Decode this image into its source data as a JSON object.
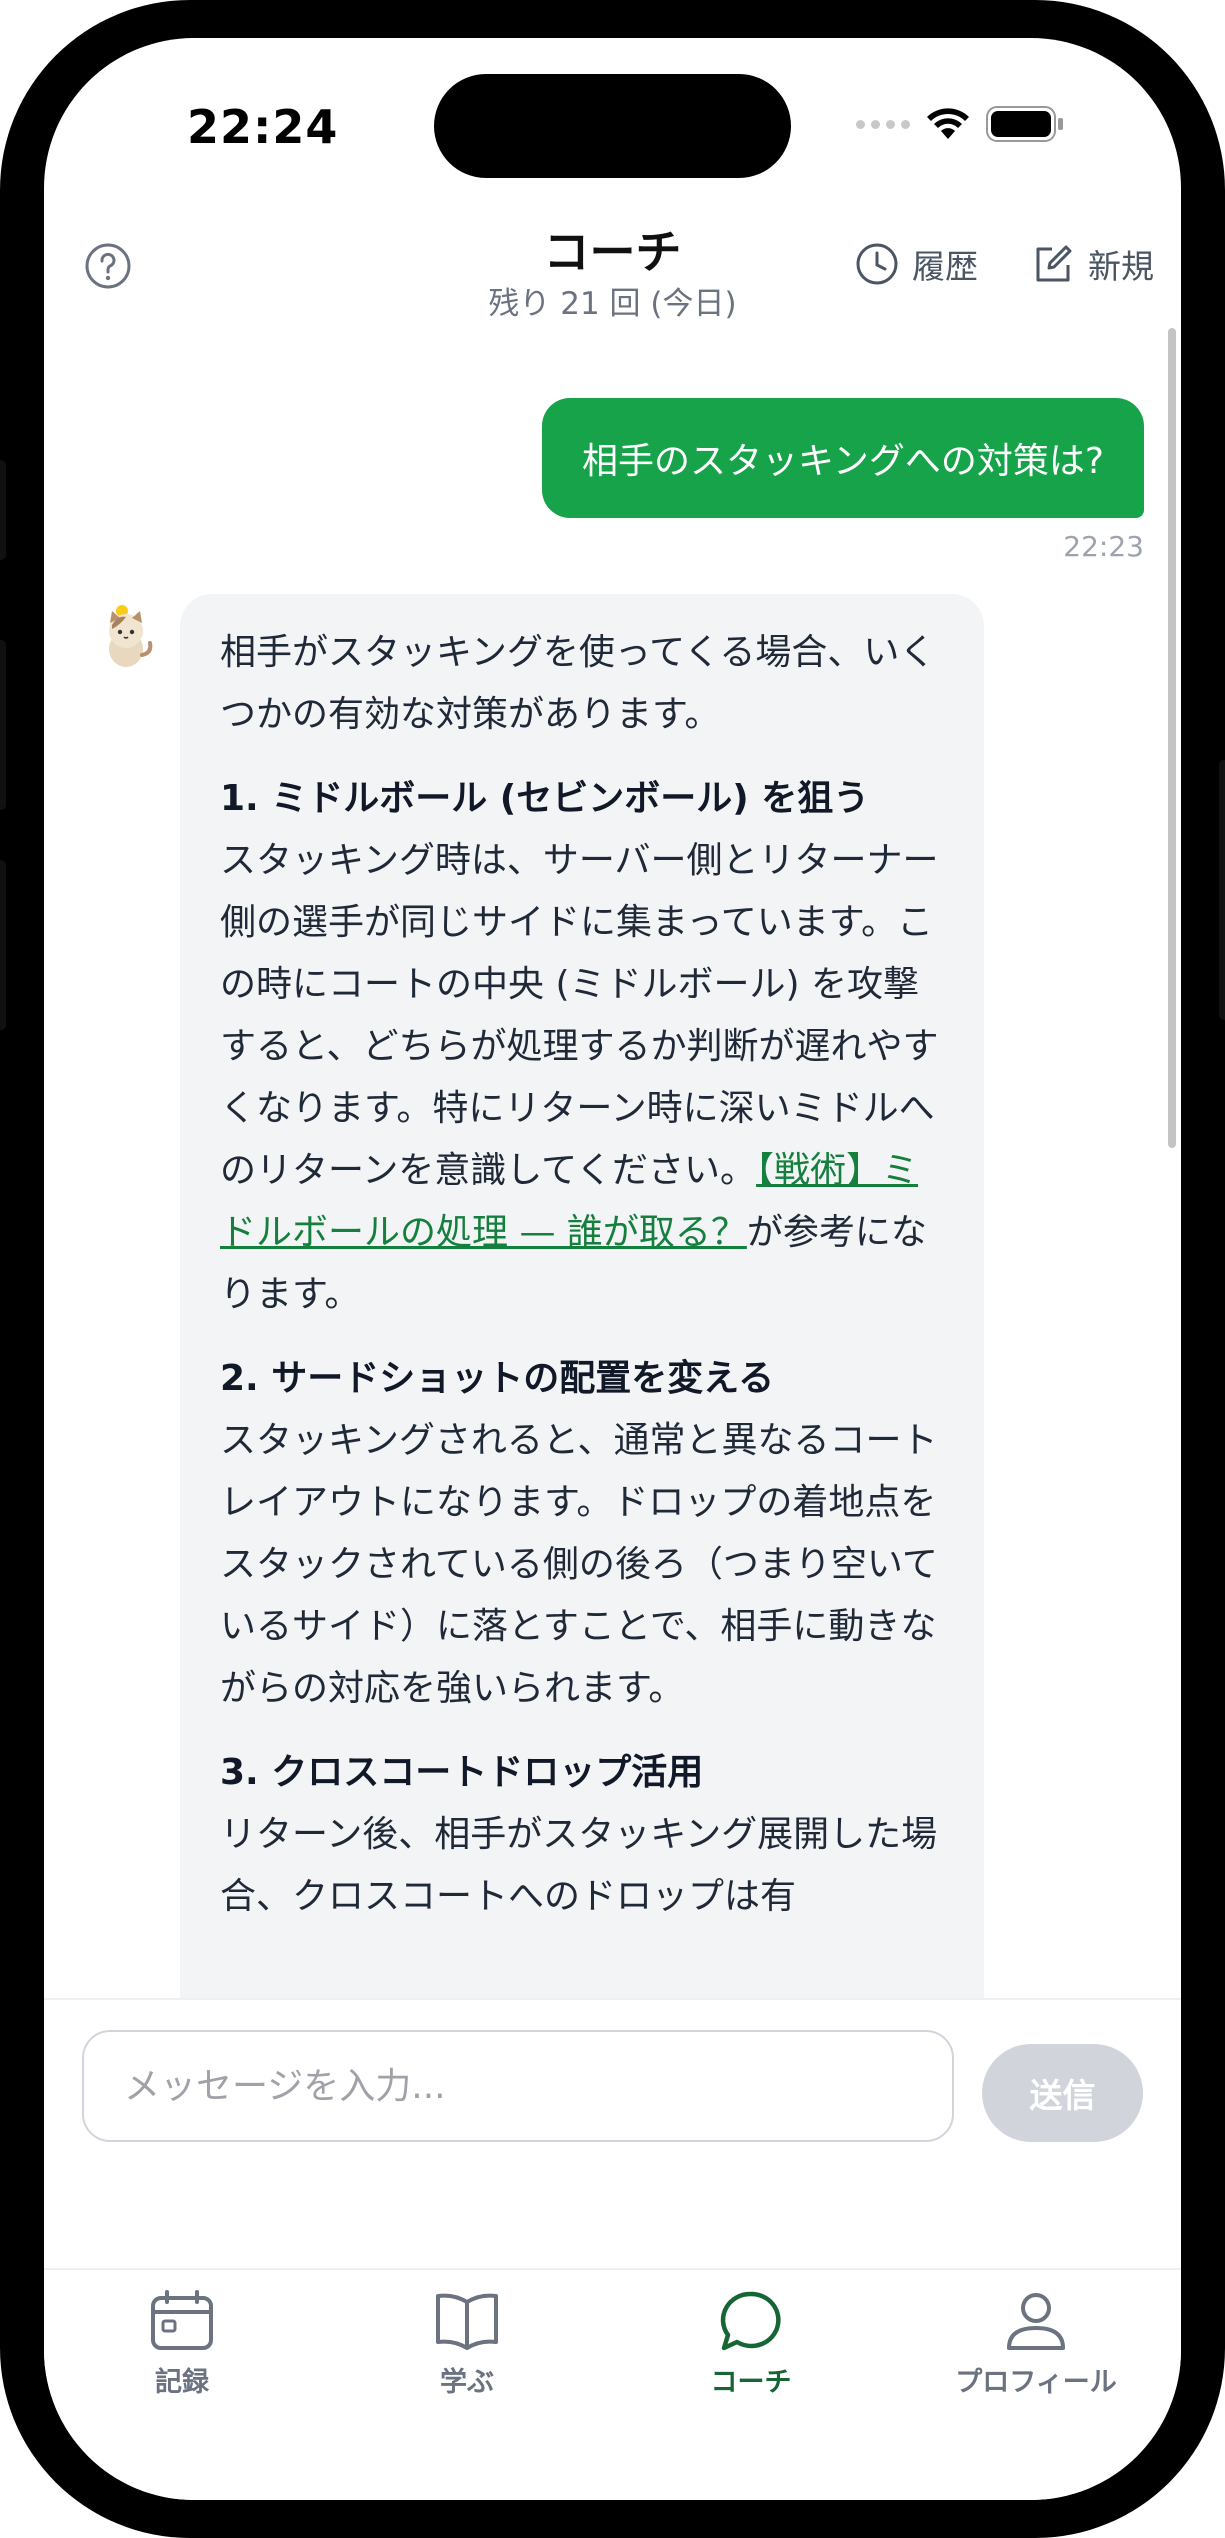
{
  "status_bar": {
    "time": "22:24"
  },
  "header": {
    "title": "コーチ",
    "subtitle": "残り 21 回 (今日)",
    "history_label": "履歴",
    "new_label": "新規"
  },
  "messages": {
    "user": {
      "text": "相手のスタッキングへの対策は?",
      "time": "22:23"
    },
    "bot": {
      "intro": "相手がスタッキングを使ってくる場合、いくつかの有効な対策があります。",
      "sections": [
        {
          "heading": "1. ミドルボール (セビンボール) を狙う",
          "body": "スタッキング時は、サーバー側とリターナー側の選手が同じサイドに集まっています。この時にコートの中央 (ミドルボール) を攻撃すると、どちらが処理するか判断が遅れやすくなります。特にリターン時に深いミドルへのリターンを意識してください。",
          "link": "【戦術】ミドルボールの処理 — 誰が取る？",
          "after_link": "が参考になります。"
        },
        {
          "heading": "2. サードショットの配置を変える",
          "body": "スタッキングされると、通常と異なるコートレイアウトになります。ドロップの着地点をスタックされている側の後ろ（つまり空いているサイド）に落とすことで、相手に動きながらの対応を強いられます。"
        },
        {
          "heading": "3. クロスコートドロップ活用",
          "body": "リターン後、相手がスタッキング展開した場合、クロスコートへのドロップは有"
        }
      ]
    }
  },
  "composer": {
    "placeholder": "メッセージを入力...",
    "send_label": "送信"
  },
  "tabs": [
    {
      "label": "記録",
      "icon": "calendar-icon",
      "active": false
    },
    {
      "label": "学ぶ",
      "icon": "book-icon",
      "active": false
    },
    {
      "label": "コーチ",
      "icon": "chat-bubble-icon",
      "active": true
    },
    {
      "label": "プロフィール",
      "icon": "person-icon",
      "active": false
    }
  ],
  "colors": {
    "accent": "#16a34a",
    "active_tab": "#166534",
    "link": "#15803d",
    "bot_bubble": "#f3f4f6",
    "send_disabled": "#d1d5db"
  }
}
